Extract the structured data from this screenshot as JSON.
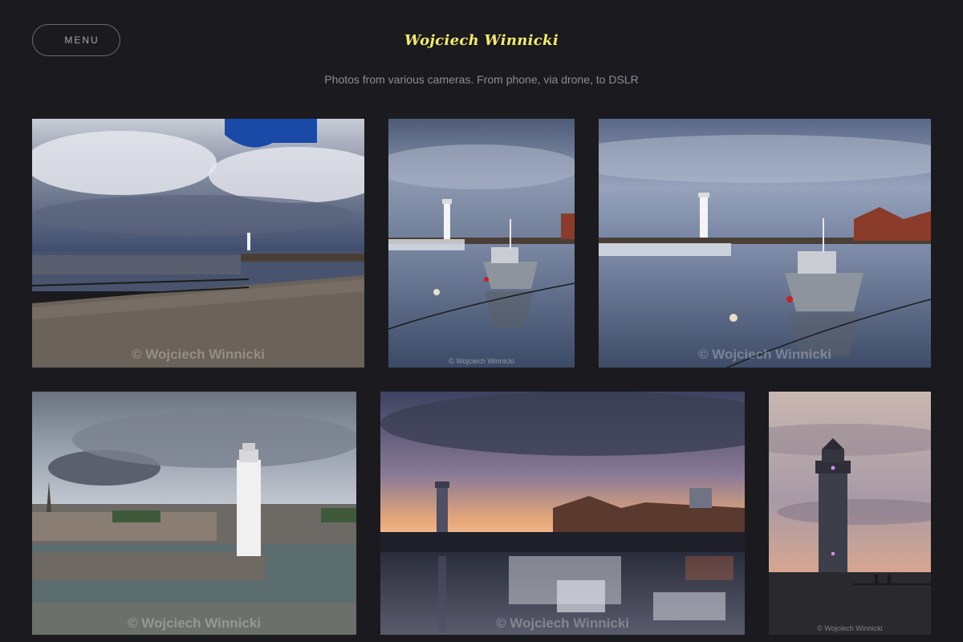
{
  "header": {
    "menu_label": "MENU",
    "site_title": "Wojciech Winnicki",
    "subtitle": "Photos from various cameras. From phone, via drone, to DSLR"
  },
  "gallery": {
    "photos": [
      {
        "watermark": "© Wojciech Winnicki"
      },
      {
        "watermark": "© Wojciech Winnicki"
      },
      {
        "watermark": "© Wojciech Winnicki"
      },
      {
        "watermark": "© Wojciech Winnicki"
      },
      {
        "watermark": "© Wojciech Winnicki"
      },
      {
        "watermark": "© Wojciech Winnicki"
      }
    ]
  },
  "colors": {
    "background": "#1b1a1f",
    "title": "#f2ec6a",
    "subtitle": "#8c8c94"
  }
}
